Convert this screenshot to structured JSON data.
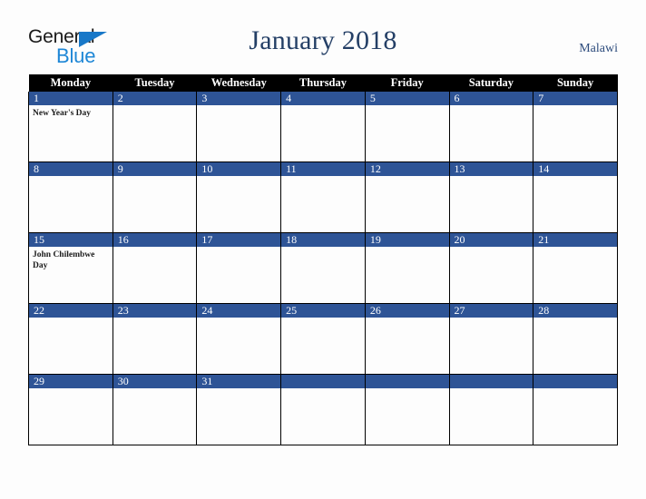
{
  "brand": {
    "name_part1": "General",
    "name_part2": "Blue",
    "triangle_color": "#1878c8",
    "blue_text_color": "#1e87d6"
  },
  "header": {
    "title": "January 2018",
    "country": "Malawi",
    "title_color": "#243f66"
  },
  "calendar": {
    "weekday_headers": [
      "Monday",
      "Tuesday",
      "Wednesday",
      "Thursday",
      "Friday",
      "Saturday",
      "Sunday"
    ],
    "header_bg": "#000000",
    "date_band_color": "#2e5496",
    "weeks": [
      [
        {
          "date": "1",
          "event": "New Year's Day"
        },
        {
          "date": "2",
          "event": ""
        },
        {
          "date": "3",
          "event": ""
        },
        {
          "date": "4",
          "event": ""
        },
        {
          "date": "5",
          "event": ""
        },
        {
          "date": "6",
          "event": ""
        },
        {
          "date": "7",
          "event": ""
        }
      ],
      [
        {
          "date": "8",
          "event": ""
        },
        {
          "date": "9",
          "event": ""
        },
        {
          "date": "10",
          "event": ""
        },
        {
          "date": "11",
          "event": ""
        },
        {
          "date": "12",
          "event": ""
        },
        {
          "date": "13",
          "event": ""
        },
        {
          "date": "14",
          "event": ""
        }
      ],
      [
        {
          "date": "15",
          "event": "John Chilembwe Day"
        },
        {
          "date": "16",
          "event": ""
        },
        {
          "date": "17",
          "event": ""
        },
        {
          "date": "18",
          "event": ""
        },
        {
          "date": "19",
          "event": ""
        },
        {
          "date": "20",
          "event": ""
        },
        {
          "date": "21",
          "event": ""
        }
      ],
      [
        {
          "date": "22",
          "event": ""
        },
        {
          "date": "23",
          "event": ""
        },
        {
          "date": "24",
          "event": ""
        },
        {
          "date": "25",
          "event": ""
        },
        {
          "date": "26",
          "event": ""
        },
        {
          "date": "27",
          "event": ""
        },
        {
          "date": "28",
          "event": ""
        }
      ],
      [
        {
          "date": "29",
          "event": ""
        },
        {
          "date": "30",
          "event": ""
        },
        {
          "date": "31",
          "event": ""
        },
        {
          "date": "",
          "event": ""
        },
        {
          "date": "",
          "event": ""
        },
        {
          "date": "",
          "event": ""
        },
        {
          "date": "",
          "event": ""
        }
      ]
    ]
  }
}
